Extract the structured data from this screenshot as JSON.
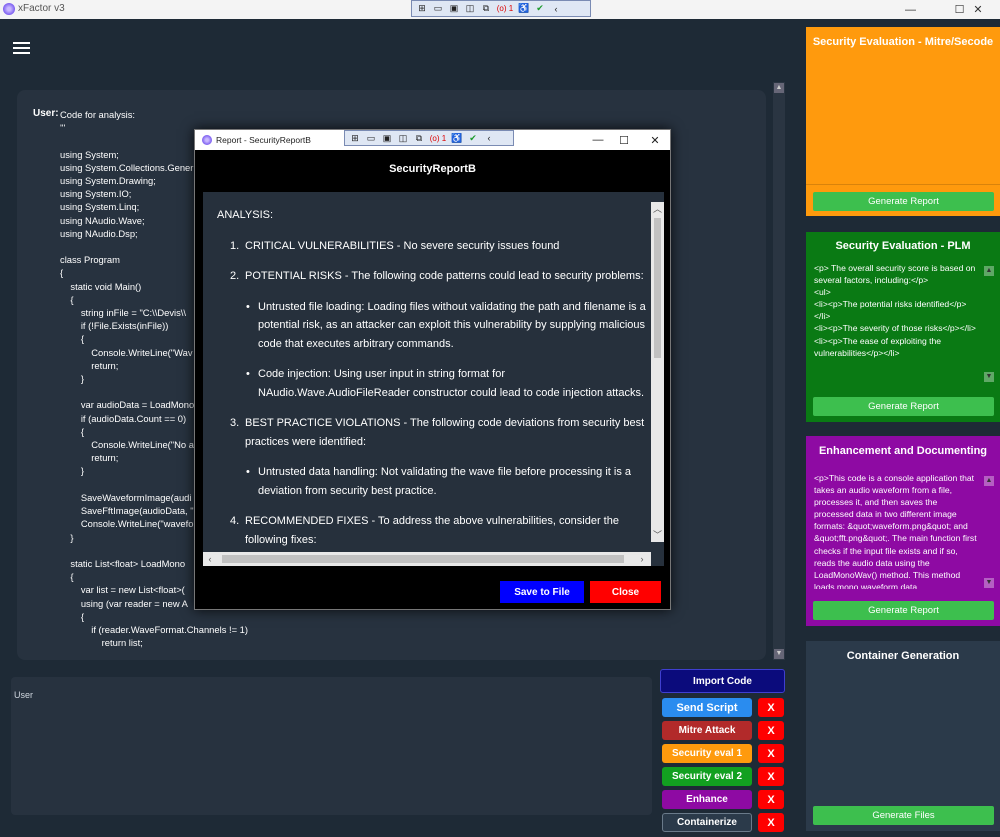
{
  "window": {
    "title": "xFactor v3",
    "minimize": "—",
    "maximize": "☐",
    "close": "✕"
  },
  "toolbar": {
    "record_count": "(o) 1"
  },
  "chat": {
    "user_label": "User:",
    "code": "Code for analysis:\n'''\n\nusing System;\nusing System.Collections.Generi\nusing System.Drawing;\nusing System.IO;\nusing System.Linq;\nusing NAudio.Wave;\nusing NAudio.Dsp;\n\nclass Program\n{\n    static void Main()\n    {\n        string inFile = \"C:\\\\Devis\\\\\n        if (!File.Exists(inFile))\n        {\n            Console.WriteLine(\"Wav\n            return;\n        }\n\n        var audioData = LoadMono\n        if (audioData.Count == 0)\n        {\n            Console.WriteLine(\"No a\n            return;\n        }\n\n        SaveWaveformImage(audi\n        SaveFftImage(audioData, \"\n        Console.WriteLine(\"wavefo\n    }\n\n    static List<float> LoadMono\n    {\n        var list = new List<float>(\n        using (var reader = new A\n        {\n            if (reader.WaveFormat.Channels != 1)\n                return list;\n\n            int sampleRate = reader.WaveFormat.SampleRate;"
  },
  "input": {
    "placeholder": "User"
  },
  "actions": {
    "import_code": "Import Code",
    "send_script": "Send Script",
    "mitre_attack": "Mitre Attack",
    "security_eval_1": "Security eval 1",
    "security_eval_2": "Security eval 2",
    "enhance": "Enhance",
    "containerize": "Containerize",
    "remove": "X"
  },
  "panels": {
    "mitre": {
      "title": "Security Evaluation - Mitre/Secode",
      "generate": "Generate Report",
      "color": "#ff9a0d"
    },
    "plm": {
      "title": "Security Evaluation - PLM",
      "body": "<p> The overall security score is based on several factors, including:</p>\n<ul>\n<li><p>The potential risks identified</p>\n</li>\n<li><p>The severity of those risks</p></li>\n<li><p>The ease of exploiting the vulnerabilities</p></li>",
      "generate": "Generate Report",
      "color": "#0a7a14"
    },
    "enhance": {
      "title": "Enhancement and Documenting",
      "body": "<p>This code is a console application that takes an audio waveform from a file, processes it, and then saves the processed data in two different image formats: &quot;waveform.png&quot; and &quot;fft.png&quot;. The main function first checks if the input file exists and if so, reads the audio data using the LoadMonoWav() method. This method loads mono waveform data",
      "generate": "Generate Report",
      "color": "#8e0aa3"
    },
    "container": {
      "title": "Container Generation",
      "generate": "Generate Files",
      "color": "#2b3a4a"
    }
  },
  "dialog": {
    "window_title": "Report - SecurityReportB",
    "heading": "SecurityReportB",
    "analysis_label": "ANALYSIS:",
    "items": [
      {
        "n": "1.",
        "text": "CRITICAL VULNERABILITIES - No severe security issues found"
      },
      {
        "n": "2.",
        "text": "POTENTIAL RISKS - The following code patterns could lead to security problems:"
      },
      {
        "b": "•",
        "text": "Untrusted file loading: Loading files without validating the path and filename is a potential risk, as an attacker can exploit this vulnerability by supplying malicious code that executes arbitrary commands."
      },
      {
        "b": "•",
        "text": "Code injection: Using user input in string format for NAudio.Wave.AudioFileReader constructor could lead to code injection attacks."
      },
      {
        "n": "3.",
        "text": "BEST PRACTICE VIOLATIONS - The following code deviations from security best practices were identified:"
      },
      {
        "b": "•",
        "text": "Untrusted data handling: Not validating the wave file before processing it is a deviation from security best practice."
      },
      {
        "n": "4.",
        "text": "RECOMMENDED FIXES - To address the above vulnerabilities, consider the following fixes:"
      }
    ],
    "save_label": "Save to File",
    "close_label": "Close",
    "save_color": "#0000ff",
    "close_color": "#ff0000"
  }
}
